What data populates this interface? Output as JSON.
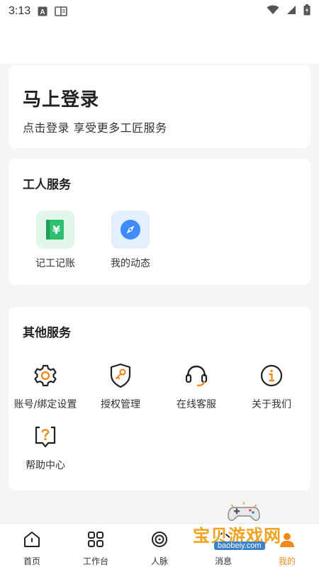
{
  "status_bar": {
    "time": "3:13"
  },
  "login": {
    "title": "马上登录",
    "subtitle": "点击登录 享受更多工匠服务"
  },
  "worker_services": {
    "title": "工人服务",
    "items": [
      {
        "label": "记工记账",
        "icon": "yuan-ledger-icon",
        "color": "#2fbf71"
      },
      {
        "label": "我的动态",
        "icon": "compass-icon",
        "color": "#3d8bfd"
      }
    ]
  },
  "other_services": {
    "title": "其他服务",
    "items": [
      {
        "label": "账号/绑定设置",
        "icon": "gear-icon"
      },
      {
        "label": "授权管理",
        "icon": "shield-key-icon"
      },
      {
        "label": "在线客服",
        "icon": "headset-icon"
      },
      {
        "label": "关于我们",
        "icon": "info-icon"
      },
      {
        "label": "帮助中心",
        "icon": "help-icon"
      }
    ]
  },
  "bottom_nav": {
    "items": [
      {
        "label": "首页",
        "icon": "home-icon"
      },
      {
        "label": "工作台",
        "icon": "grid-icon"
      },
      {
        "label": "人脉",
        "icon": "contacts-icon"
      },
      {
        "label": "消息",
        "icon": "message-icon"
      },
      {
        "label": "我的",
        "icon": "profile-icon",
        "active": true
      }
    ]
  },
  "watermark": {
    "text": "宝贝游戏网",
    "url": "baobeiy.com"
  },
  "colors": {
    "accent": "#f08a1c",
    "icon_dark": "#222222"
  }
}
